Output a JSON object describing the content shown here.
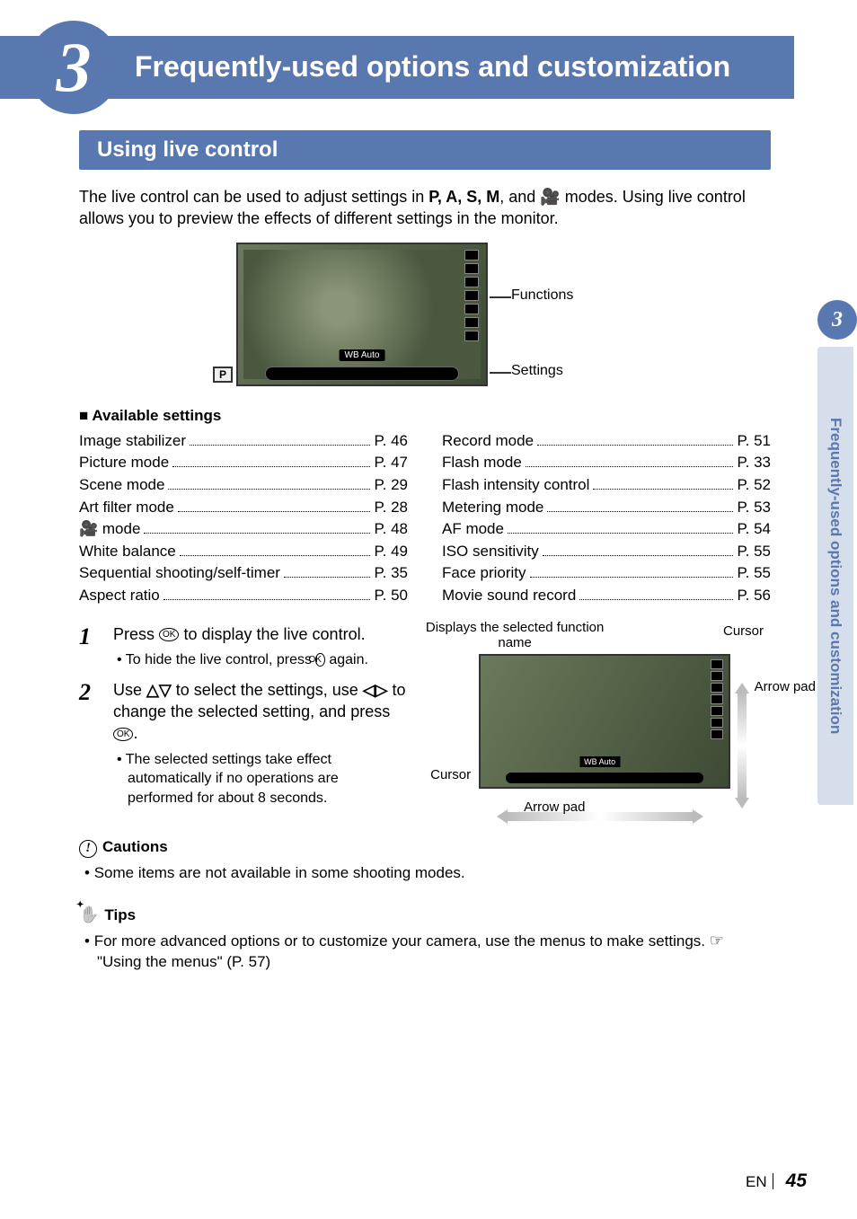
{
  "chapter": {
    "number": "3",
    "title": "Frequently-used options and customization"
  },
  "section_title": "Using live control",
  "intro_pre": "The live control can be used to adjust settings in ",
  "intro_modes": "P, A, S, M",
  "intro_mid": ", and ",
  "intro_movie_glyph": "🎥",
  "intro_post": " modes. Using live control allows you to preview the effects of different settings in the monitor.",
  "lcd": {
    "wb_label": "WB Auto",
    "p_box": "P",
    "functions_label": "Functions",
    "settings_label": "Settings"
  },
  "available_heading": "Available settings",
  "toc_left": [
    {
      "label": "Image stabilizer",
      "page": "P. 46"
    },
    {
      "label": "Picture mode",
      "page": "P. 47"
    },
    {
      "label": "Scene mode",
      "page": "P. 29"
    },
    {
      "label": "Art filter mode",
      "page": "P. 28"
    },
    {
      "label": "🎥 mode",
      "page": "P. 48"
    },
    {
      "label": "White balance",
      "page": "P. 49"
    },
    {
      "label": "Sequential shooting/self-timer",
      "page": "P. 35"
    },
    {
      "label": "Aspect ratio",
      "page": "P. 50"
    }
  ],
  "toc_right": [
    {
      "label": "Record mode",
      "page": "P. 51"
    },
    {
      "label": "Flash mode",
      "page": "P. 33"
    },
    {
      "label": "Flash intensity control",
      "page": "P. 52"
    },
    {
      "label": "Metering mode",
      "page": "P. 53"
    },
    {
      "label": "AF mode",
      "page": "P. 54"
    },
    {
      "label": "ISO sensitivity",
      "page": "P. 55"
    },
    {
      "label": "Face priority",
      "page": "P. 55"
    },
    {
      "label": "Movie sound record",
      "page": "P. 56"
    }
  ],
  "step1": {
    "num": "1",
    "text_pre": "Press ",
    "ok": "OK",
    "text_post": " to display the live control.",
    "sub_pre": "To hide the live control, press ",
    "sub_post": " again."
  },
  "step2": {
    "num": "2",
    "line1_pre": "Use ",
    "ud": "△▽",
    "line1_mid": " to select the settings, use ",
    "lr": "◁▷",
    "line1_post": " to change the selected setting, and press ",
    "sub": "The selected settings take effect automatically if no operations are performed for about 8 seconds."
  },
  "diagram": {
    "top_left": "Displays the selected function name",
    "cursor": "Cursor",
    "arrow_pad": "Arrow pad",
    "wb": "WB Auto"
  },
  "cautions": {
    "heading": "Cautions",
    "item": "Some items are not available in some shooting modes."
  },
  "tips": {
    "heading": "Tips",
    "item_pre": "For more advanced options or to customize your camera, use the menus to make settings. ",
    "ref_glyph": "☞",
    "ref_text": " \"Using the menus\" (P. 57)"
  },
  "side": {
    "num": "3",
    "text": "Frequently-used options and customization"
  },
  "footer": {
    "lang": "EN",
    "page": "45"
  }
}
